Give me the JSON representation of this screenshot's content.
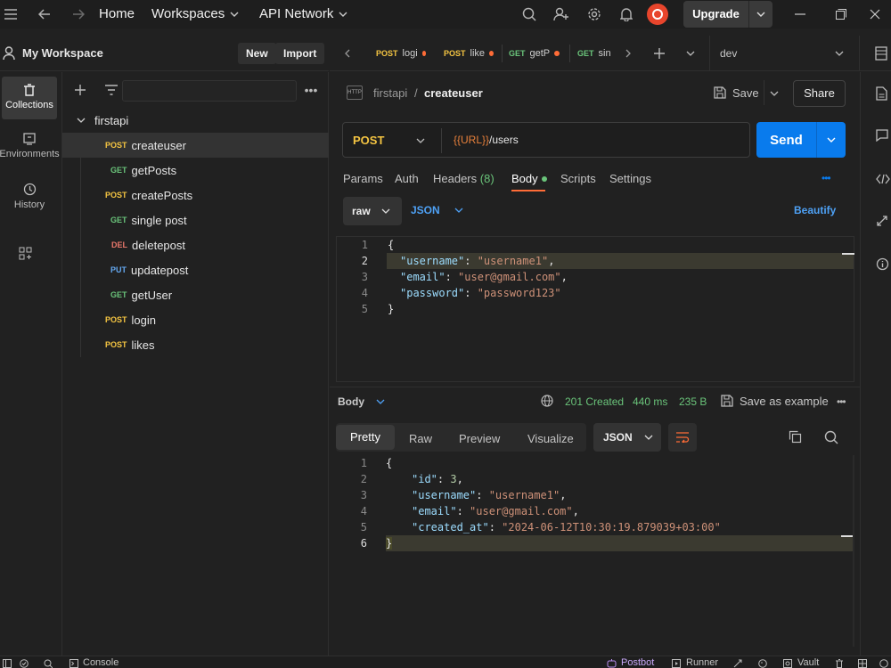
{
  "topbar": {
    "home": "Home",
    "workspaces": "Workspaces",
    "api_network": "API Network",
    "upgrade": "Upgrade"
  },
  "workspace": {
    "name": "My Workspace",
    "new_label": "New",
    "import_label": "Import"
  },
  "rail": {
    "items": [
      {
        "label": "Collections",
        "icon": "trash-can-icon"
      },
      {
        "label": "Environments",
        "icon": "environment-icon"
      },
      {
        "label": "History",
        "icon": "history-icon"
      }
    ]
  },
  "collection": {
    "name": "firstapi",
    "requests": [
      {
        "method": "POST",
        "name": "createuser"
      },
      {
        "method": "GET",
        "name": "getPosts"
      },
      {
        "method": "POST",
        "name": "createPosts"
      },
      {
        "method": "GET",
        "name": "single post"
      },
      {
        "method": "DEL",
        "name": "deletepost"
      },
      {
        "method": "PUT",
        "name": "updatepost"
      },
      {
        "method": "GET",
        "name": "getUser"
      },
      {
        "method": "POST",
        "name": "login"
      },
      {
        "method": "POST",
        "name": "likes"
      }
    ]
  },
  "tabs": [
    {
      "method": "POST",
      "name": "logi"
    },
    {
      "method": "POST",
      "name": "like"
    },
    {
      "method": "GET",
      "name": "getP"
    },
    {
      "method": "GET",
      "name": "sin"
    }
  ],
  "environment": "dev",
  "request": {
    "breadcrumb_collection": "firstapi",
    "breadcrumb_sep": "/",
    "name": "createuser",
    "save": "Save",
    "share": "Share",
    "method": "POST",
    "url_var": "{{URL}}",
    "url_path": "/users",
    "send": "Send",
    "tabs": {
      "params": "Params",
      "auth": "Auth",
      "headers": "Headers",
      "headers_count": "(8)",
      "body": "Body",
      "scripts": "Scripts",
      "settings": "Settings"
    },
    "body_mode": "raw",
    "body_format": "JSON",
    "beautify": "Beautify",
    "body_lines": [
      {
        "num": "1",
        "text": "{"
      },
      {
        "num": "2",
        "key": "\"username\"",
        "value": "\"username1\"",
        "tail": ","
      },
      {
        "num": "3",
        "key": "\"email\"",
        "value": "\"user@gmail.com\"",
        "tail": ","
      },
      {
        "num": "4",
        "key": "\"password\"",
        "value": "\"password123\"",
        "tail": ""
      },
      {
        "num": "5",
        "text": "}"
      }
    ]
  },
  "response": {
    "label": "Body",
    "status": "201 Created",
    "time": "440 ms",
    "size": "235 B",
    "save_example": "Save as example",
    "tabs": [
      "Pretty",
      "Raw",
      "Preview",
      "Visualize"
    ],
    "format": "JSON",
    "lines": [
      {
        "num": "1",
        "text": "{"
      },
      {
        "num": "2",
        "key": "\"id\"",
        "value": "3",
        "type": "n",
        "tail": ","
      },
      {
        "num": "3",
        "key": "\"username\"",
        "value": "\"username1\"",
        "type": "s",
        "tail": ","
      },
      {
        "num": "4",
        "key": "\"email\"",
        "value": "\"user@gmail.com\"",
        "type": "s",
        "tail": ","
      },
      {
        "num": "5",
        "key": "\"created_at\"",
        "value": "\"2024-06-12T10:30:19.879039+03:00\"",
        "type": "s",
        "tail": ""
      },
      {
        "num": "6",
        "text": "}"
      }
    ]
  },
  "statusbar": {
    "console": "Console",
    "postbot": "Postbot",
    "runner": "Runner",
    "vault": "Vault"
  },
  "colors": {
    "accent": "#097bed",
    "brand": "#ff6c37",
    "ok": "#6ac47a"
  }
}
